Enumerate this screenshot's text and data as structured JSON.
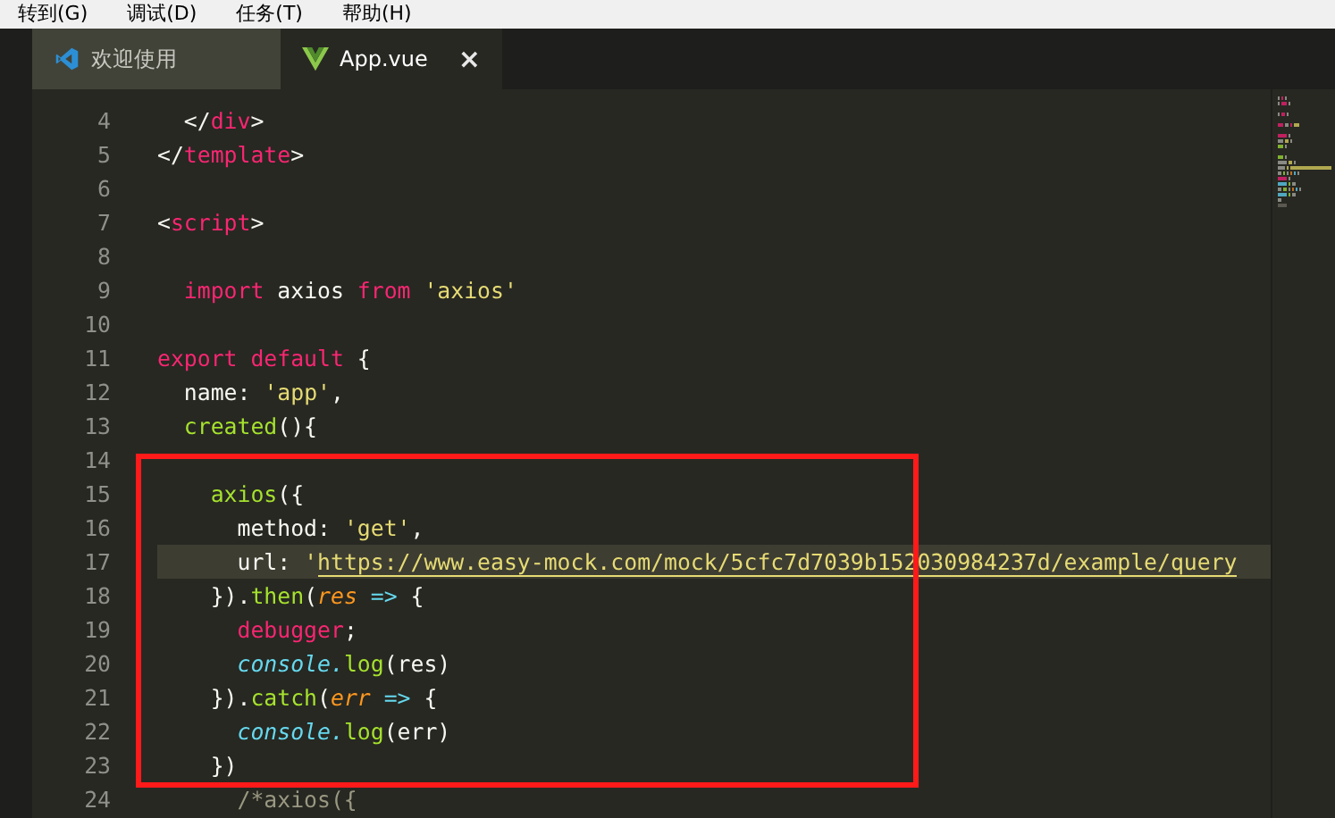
{
  "menu": [
    "转到(G)",
    "调试(D)",
    "任务(T)",
    "帮助(H)"
  ],
  "tabs": [
    {
      "label": "欢迎使用",
      "selected": false
    },
    {
      "label": "App.vue",
      "selected": true,
      "close_glyph": "×"
    }
  ],
  "editor": {
    "lines": [
      {
        "number": "4",
        "current": false,
        "tokens": [
          {
            "kind": "punct",
            "text": "  </"
          },
          {
            "kind": "tag",
            "text": "div"
          },
          {
            "kind": "punct",
            "text": ">"
          }
        ]
      },
      {
        "number": "5",
        "current": false,
        "tokens": [
          {
            "kind": "punct",
            "text": "</"
          },
          {
            "kind": "tag",
            "text": "template"
          },
          {
            "kind": "punct",
            "text": ">"
          }
        ]
      },
      {
        "number": "6",
        "current": false
      },
      {
        "number": "7",
        "current": false,
        "tokens": [
          {
            "kind": "punct",
            "text": "<"
          },
          {
            "kind": "tag",
            "text": "script"
          },
          {
            "kind": "punct",
            "text": ">"
          }
        ]
      },
      {
        "number": "8",
        "current": false
      },
      {
        "number": "9",
        "current": false,
        "tokens": [
          {
            "kind": "keyword",
            "text": "  import"
          },
          {
            "kind": "plain",
            "text": " axios "
          },
          {
            "kind": "keyword",
            "text": "from"
          },
          {
            "kind": "string",
            "text": " 'axios'"
          }
        ]
      },
      {
        "number": "10",
        "current": false
      },
      {
        "number": "11",
        "current": false,
        "tokens": [
          {
            "kind": "keyword",
            "text": "export default"
          },
          {
            "kind": "plain",
            "text": " {"
          }
        ]
      },
      {
        "number": "12",
        "current": false,
        "tokens": [
          {
            "kind": "plain",
            "text": "  name: "
          },
          {
            "kind": "string",
            "text": "'app'"
          },
          {
            "kind": "plain",
            "text": ","
          }
        ]
      },
      {
        "number": "13",
        "current": false,
        "tokens": [
          {
            "kind": "func",
            "text": "  created"
          },
          {
            "kind": "plain",
            "text": "(){"
          }
        ]
      },
      {
        "number": "14",
        "current": false
      },
      {
        "number": "15",
        "current": false,
        "tokens": [
          {
            "kind": "func",
            "text": "    axios"
          },
          {
            "kind": "plain",
            "text": "({"
          }
        ]
      },
      {
        "number": "16",
        "current": false,
        "tokens": [
          {
            "kind": "plain",
            "text": "      method: "
          },
          {
            "kind": "string",
            "text": "'get'"
          },
          {
            "kind": "plain",
            "text": ","
          }
        ]
      },
      {
        "number": "17",
        "current": true,
        "tokens": [
          {
            "kind": "plain",
            "text": "      url: "
          },
          {
            "kind": "string",
            "text": "'"
          },
          {
            "kind": "link",
            "text": "https://www.easy-mock.com/mock/5cfc7d7039b152030984237d/example/query"
          }
        ]
      },
      {
        "number": "18",
        "current": false,
        "tokens": [
          {
            "kind": "plain",
            "text": "    })."
          },
          {
            "kind": "func",
            "text": "then"
          },
          {
            "kind": "plain",
            "text": "("
          },
          {
            "kind": "param",
            "text": "res"
          },
          {
            "kind": "arrow",
            "text": " =>"
          },
          {
            "kind": "plain",
            "text": " {"
          }
        ]
      },
      {
        "number": "19",
        "current": false,
        "tokens": [
          {
            "kind": "keyword",
            "text": "      debugger"
          },
          {
            "kind": "plain",
            "text": ";"
          }
        ]
      },
      {
        "number": "20",
        "current": false,
        "tokens": [
          {
            "kind": "builtin",
            "text": "      console."
          },
          {
            "kind": "func",
            "text": "log"
          },
          {
            "kind": "plain",
            "text": "(res)"
          }
        ]
      },
      {
        "number": "21",
        "current": false,
        "tokens": [
          {
            "kind": "plain",
            "text": "    })."
          },
          {
            "kind": "func",
            "text": "catch"
          },
          {
            "kind": "plain",
            "text": "("
          },
          {
            "kind": "param",
            "text": "err"
          },
          {
            "kind": "arrow",
            "text": " =>"
          },
          {
            "kind": "plain",
            "text": " {"
          }
        ]
      },
      {
        "number": "22",
        "current": false,
        "tokens": [
          {
            "kind": "builtin",
            "text": "      console."
          },
          {
            "kind": "func",
            "text": "log"
          },
          {
            "kind": "plain",
            "text": "(err)"
          }
        ]
      },
      {
        "number": "23",
        "current": false,
        "tokens": [
          {
            "kind": "plain",
            "text": "    })"
          }
        ]
      },
      {
        "number": "24",
        "current": false,
        "tokens": [
          {
            "kind": "comment",
            "text": "      /*axios({"
          }
        ]
      }
    ]
  }
}
